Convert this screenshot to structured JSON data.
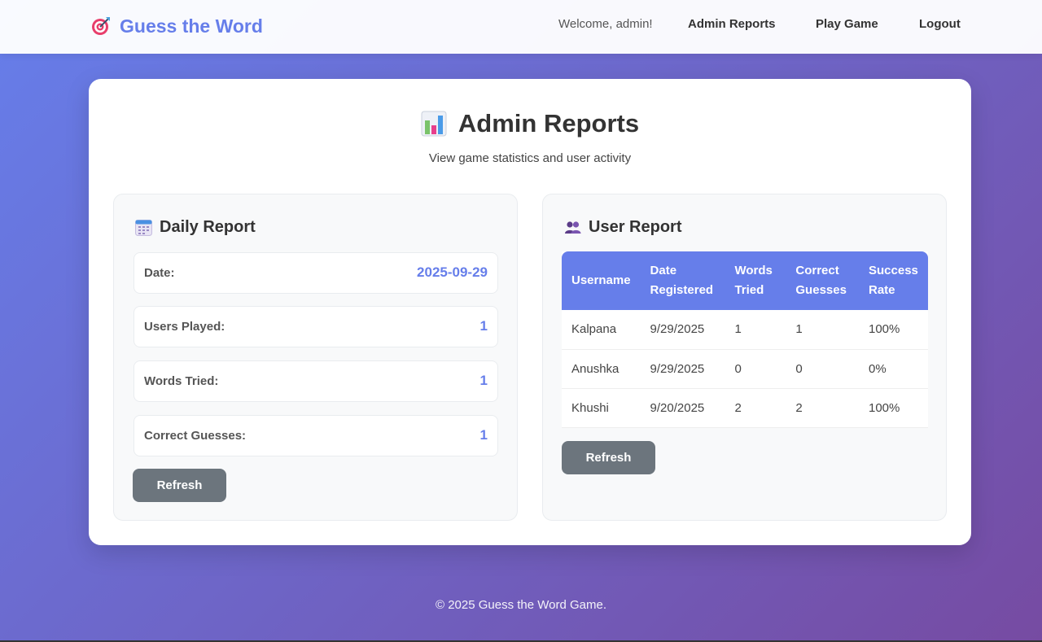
{
  "navbar": {
    "brand": "Guess the Word",
    "brand_icon": "target-icon",
    "welcome": "Welcome, admin!",
    "links": [
      "Admin Reports",
      "Play Game",
      "Logout"
    ]
  },
  "header": {
    "title": "Admin Reports",
    "title_icon": "bar-chart-icon",
    "subtitle": "View game statistics and user activity"
  },
  "daily_report": {
    "title": "Daily Report",
    "title_icon": "calendar-icon",
    "stats": [
      {
        "label": "Date:",
        "value": "2025-09-29"
      },
      {
        "label": "Users Played:",
        "value": "1"
      },
      {
        "label": "Words Tried:",
        "value": "1"
      },
      {
        "label": "Correct Guesses:",
        "value": "1"
      }
    ],
    "refresh_label": "Refresh"
  },
  "user_report": {
    "title": "User Report",
    "title_icon": "users-icon",
    "columns": [
      [
        "Username"
      ],
      [
        "Date",
        "Registered"
      ],
      [
        "Words",
        "Tried"
      ],
      [
        "Correct",
        "Guesses"
      ],
      [
        "Success",
        "Rate"
      ]
    ],
    "rows": [
      [
        "Kalpana",
        "9/29/2025",
        "1",
        "1",
        "100%"
      ],
      [
        "Anushka",
        "9/29/2025",
        "0",
        "0",
        "0%"
      ],
      [
        "Khushi",
        "9/20/2025",
        "2",
        "2",
        "100%"
      ]
    ],
    "refresh_label": "Refresh"
  },
  "footer": {
    "text": "© 2025 Guess the Word Game."
  },
  "colors": {
    "accent": "#667eea",
    "gradient_end": "#764ba2",
    "button_gray": "#6c757d"
  }
}
